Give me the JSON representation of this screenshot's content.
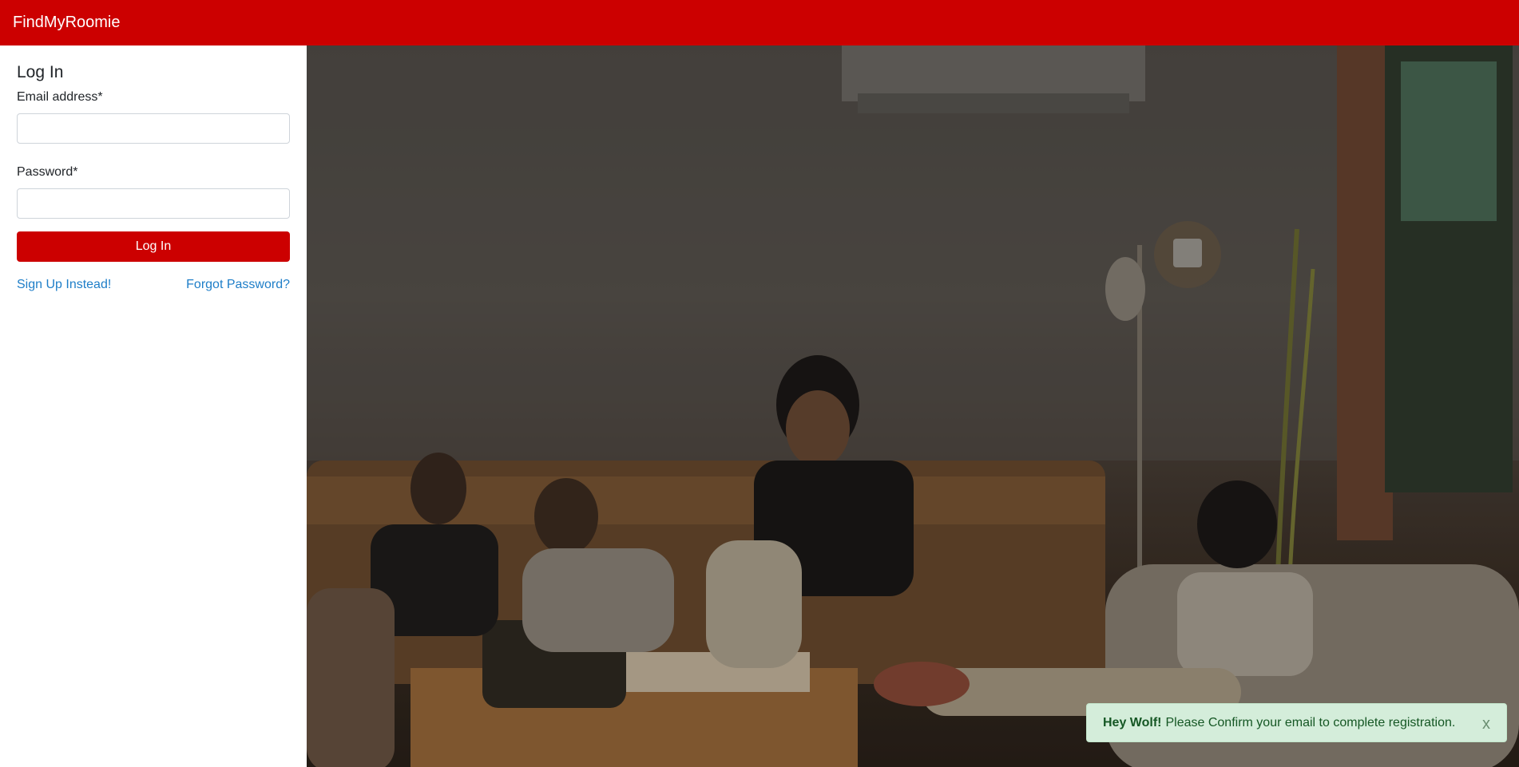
{
  "app": {
    "brand": "FindMyRoomie"
  },
  "login": {
    "title": "Log In",
    "email_label": "Email address*",
    "email_value": "",
    "password_label": "Password*",
    "password_value": "",
    "submit_label": "Log In",
    "signup_link": "Sign Up Instead!",
    "forgot_link": "Forgot Password?"
  },
  "notification": {
    "greeting": "Hey Wolf!",
    "message": "Please Confirm your email to complete registration.",
    "close_label": "x"
  },
  "colors": {
    "brand": "#cc0000",
    "link": "#1e7ec8",
    "toast_bg": "#d4edda",
    "toast_text": "#155724"
  }
}
